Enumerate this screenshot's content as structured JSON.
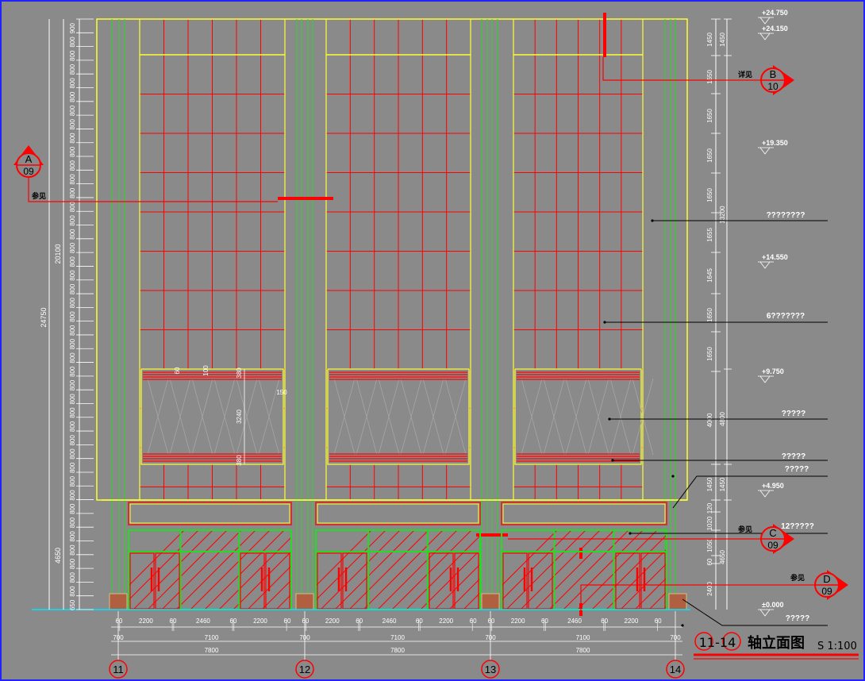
{
  "drawing": {
    "title_axes": "11-14",
    "title_text": "轴立面图",
    "scale": "S 1:100"
  },
  "axes": [
    "11",
    "12",
    "13",
    "14"
  ],
  "callouts": {
    "A": {
      "letter": "A",
      "sheet": "09",
      "note": "参见"
    },
    "B": {
      "letter": "B",
      "sheet": "10",
      "note": "详见"
    },
    "C": {
      "letter": "C",
      "sheet": "09",
      "note": "参见"
    },
    "D": {
      "letter": "D",
      "sheet": "09",
      "note": "参见"
    }
  },
  "elevations": [
    "+24.750",
    "+24.150",
    "+19.350",
    "+14.550",
    "+9.750",
    "+4.950",
    "±0.000"
  ],
  "left_dims": {
    "rows": [
      "900",
      "800",
      "800",
      "800",
      "800",
      "800",
      "800",
      "800",
      "800",
      "800",
      "800",
      "800",
      "800",
      "800",
      "800",
      "800",
      "800",
      "800",
      "800",
      "800",
      "800",
      "800",
      "800",
      "800",
      "800",
      "800",
      "800",
      "800",
      "800",
      "800",
      "800",
      "800",
      "800",
      "800",
      "800",
      "800",
      "800",
      "800",
      "800",
      "800",
      "800",
      "800",
      "650"
    ],
    "upper_total": "20100",
    "lower_total": "4650",
    "grand_total": "24750"
  },
  "right_dims": {
    "col1": [
      "1450",
      "1650",
      "1650",
      "1650",
      "1650",
      "1655",
      "1645",
      "1650",
      "1650",
      "4000",
      "1450",
      "120",
      "1020",
      "1050",
      "60",
      "2400"
    ],
    "col2": [
      "1450",
      "13200",
      "4800",
      "1450",
      "4650"
    ]
  },
  "panel_dims": [
    "60",
    "100",
    "380",
    "3240",
    "150",
    "380"
  ],
  "bottom_dims": {
    "segments": [
      "60",
      "2200",
      "60",
      "2460",
      "60",
      "2200",
      "60",
      "60",
      "2200",
      "60",
      "2460",
      "60",
      "2200",
      "60",
      "60",
      "2200",
      "60",
      "2460",
      "60",
      "2200",
      "60"
    ],
    "offsets": [
      "700",
      "700",
      "700",
      "700"
    ],
    "bays": [
      "7100",
      "7100",
      "7100"
    ],
    "totals": [
      "7800",
      "7800",
      "7800"
    ]
  },
  "notes": [
    "????????",
    "6???????",
    "?????",
    "?????",
    "?????",
    "12?????",
    "?????"
  ],
  "colors": {
    "background": "#8a8a8a",
    "grid_red": "#ff0000",
    "frame_yellow": "#ffff33",
    "mullion_green": "#22dd22",
    "dim_white": "#ffffff",
    "ground_cyan": "#00e5ff"
  }
}
